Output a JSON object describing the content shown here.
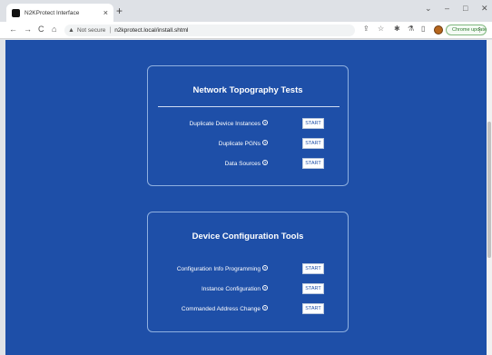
{
  "browser": {
    "tab_title": "N2KProtect Interface",
    "tab_close": "×",
    "new_tab": "+",
    "minimize": "–",
    "maximize": "□",
    "close": "✕",
    "collapse": "⌄",
    "back": "←",
    "forward": "→",
    "reload": "C",
    "home": "⌂",
    "warning_icon": "▲",
    "not_secure": "Not secure",
    "separator": "|",
    "url": "n2kprotect.local/install.shtml",
    "share_icon": "⇪",
    "star_icon": "☆",
    "extensions_icon": "✱",
    "flask_icon": "⚗",
    "sidebar_icon": "▯",
    "update_label": "Chrome update",
    "menu_dots": "⋮"
  },
  "sections": [
    {
      "title": "Network Topography Tests",
      "items": [
        {
          "label": "Duplicate Device Instances",
          "help": "?",
          "button": "START"
        },
        {
          "label": "Duplicate PGNs",
          "help": "?",
          "button": "START"
        },
        {
          "label": "Data Sources",
          "help": "?",
          "button": "START"
        }
      ]
    },
    {
      "title": "Device Configuration Tools",
      "items": [
        {
          "label": "Configuration Info Programming",
          "help": "?",
          "button": "START"
        },
        {
          "label": "Instance Configuration",
          "help": "?",
          "button": "START"
        },
        {
          "label": "Commanded Address Change",
          "help": "?",
          "button": "START"
        }
      ]
    }
  ],
  "colors": {
    "page_background": "#1e4fa8",
    "card_border": "#8fb0e0",
    "button_text": "#1e4fa8"
  }
}
